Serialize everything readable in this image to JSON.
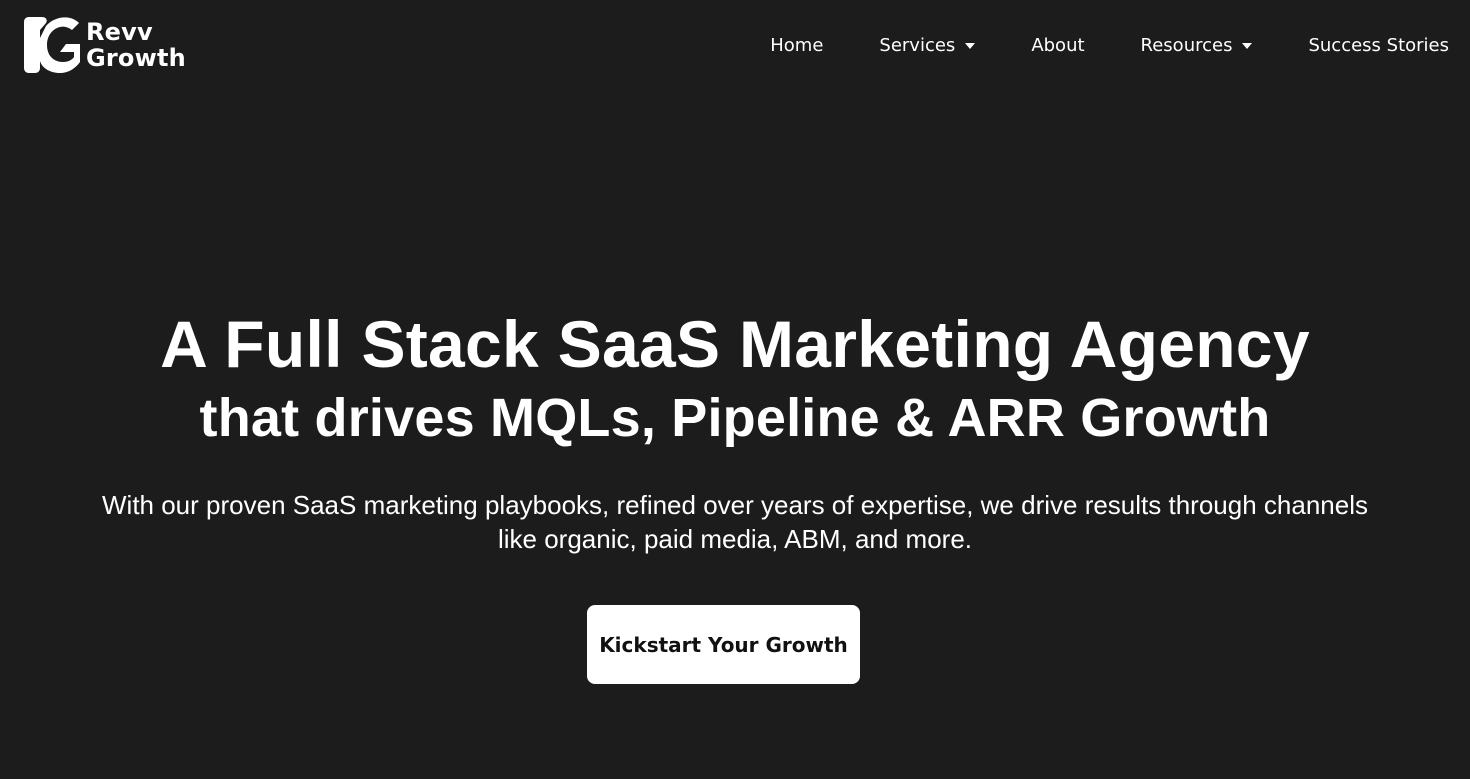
{
  "brand": {
    "logo_icon": "revv-growth-logo-mark",
    "name_line1": "Revv",
    "name_line2": "Growth"
  },
  "nav": {
    "items": [
      {
        "label": "Home",
        "has_dropdown": false
      },
      {
        "label": "Services",
        "has_dropdown": true
      },
      {
        "label": "About",
        "has_dropdown": false
      },
      {
        "label": "Resources",
        "has_dropdown": true
      },
      {
        "label": "Success Stories",
        "has_dropdown": false
      }
    ],
    "dropdown_icon": "caret-down-icon"
  },
  "hero": {
    "title": "A Full Stack SaaS Marketing Agency",
    "subtitle": "that drives MQLs, Pipeline & ARR Growth",
    "description": "With our proven SaaS marketing playbooks, refined over years of expertise, we drive results through channels like organic, paid media, ABM, and more.",
    "cta_label": "Kickstart Your Growth"
  },
  "colors": {
    "background": "#1c1c1c",
    "text": "#ffffff",
    "button_bg": "#ffffff",
    "button_text": "#111111"
  }
}
